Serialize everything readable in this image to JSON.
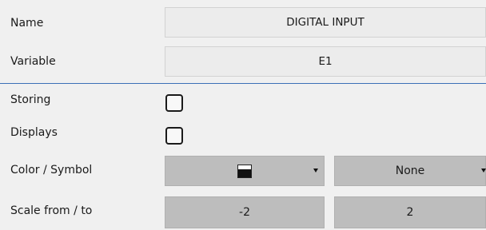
{
  "name": {
    "label": "Name",
    "value": "DIGITAL INPUT"
  },
  "variable": {
    "label": "Variable",
    "value": "E1"
  },
  "storing": {
    "label": "Storing",
    "checked": false
  },
  "displays": {
    "label": "Displays",
    "checked": false
  },
  "color_symbol": {
    "label": "Color / Symbol",
    "color_icon": "black-square-swatch-icon",
    "symbol_value": "None"
  },
  "scale": {
    "label": "Scale from / to",
    "from": "-2",
    "to": "2"
  },
  "colors": {
    "divider": "#3b6fb6",
    "dropdown_bg": "#bdbdbd",
    "field_bg": "#ececec"
  }
}
